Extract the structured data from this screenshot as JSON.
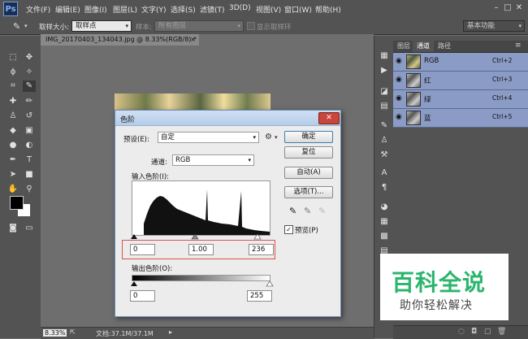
{
  "app": {
    "logo": "Ps"
  },
  "menubar": {
    "items": [
      "文件(F)",
      "编辑(E)",
      "图像(I)",
      "图层(L)",
      "文字(Y)",
      "选择(S)",
      "滤镜(T)",
      "3D(D)",
      "视图(V)",
      "窗口(W)",
      "帮助(H)"
    ],
    "window_buttons": [
      "–",
      "□",
      "✕"
    ]
  },
  "options_bar": {
    "sample_size_label": "取样大小:",
    "sample_size_value": "取样点",
    "sample_label": "样本:",
    "sample_value": "所有图层",
    "show_ring_label": "显示取样环",
    "workspace": "基本功能"
  },
  "document": {
    "tab_title": "IMG_20170403_134043.jpg @ 8.33%(RGB/8) *",
    "zoom": "8.33%",
    "doc_info": "文档:37.1M/37.1M"
  },
  "channels_panel": {
    "tabs": [
      "图层",
      "通道",
      "路径"
    ],
    "active_tab": "通道",
    "channels": [
      {
        "name": "RGB",
        "shortcut": "Ctrl+2"
      },
      {
        "name": "红",
        "shortcut": "Ctrl+3"
      },
      {
        "name": "绿",
        "shortcut": "Ctrl+4"
      },
      {
        "name": "蓝",
        "shortcut": "Ctrl+5"
      }
    ]
  },
  "levels_dialog": {
    "title": "色阶",
    "preset_label": "预设(E):",
    "preset_value": "自定",
    "channel_label": "通道:",
    "channel_value": "RGB",
    "input_levels_label": "输入色阶(I):",
    "input_black": "0",
    "input_mid": "1.00",
    "input_white": "236",
    "output_levels_label": "输出色阶(O):",
    "output_black": "0",
    "output_white": "255",
    "buttons": {
      "ok": "确定",
      "reset": "复位",
      "auto": "自动(A)",
      "options": "选项(T)..."
    },
    "preview_label": "预览(P)",
    "preview_checked": true
  },
  "watermark": {
    "title": "百科全说",
    "subtitle": "助你轻松解决"
  },
  "colors": {
    "accent": "#8a9bc5",
    "highlight_border": "#d9534f",
    "watermark_green": "#2bb56d"
  }
}
